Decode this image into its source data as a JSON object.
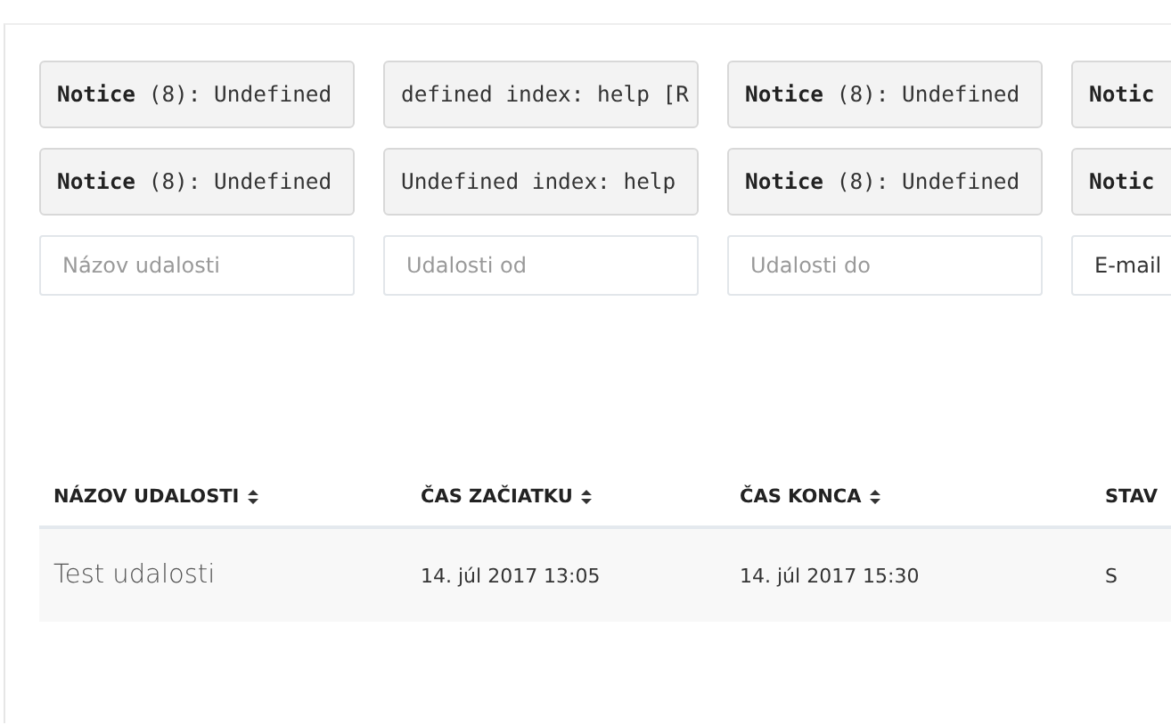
{
  "filter_columns": [
    {
      "notices": [
        "**Notice** (8): Undefined",
        "**Notice** (8): Undefined"
      ],
      "field": {
        "placeholder": "Názov udalosti"
      }
    },
    {
      "notices": [
        "defined index: help [R",
        "Undefined index: help"
      ],
      "field": {
        "placeholder": "Udalosti od"
      }
    },
    {
      "notices": [
        "**Notice** (8): Undefined",
        "**Notice** (8): Undefined"
      ],
      "field": {
        "placeholder": "Udalosti do"
      }
    },
    {
      "notices": [
        "**Notic**",
        "**Notic**"
      ],
      "field": {
        "value": "E-mail"
      }
    }
  ],
  "table": {
    "columns": [
      {
        "label": "NÁZOV UDALOSTI",
        "sortable": true
      },
      {
        "label": "ČAS ZAČIATKU",
        "sortable": true
      },
      {
        "label": "ČAS KONCA",
        "sortable": true
      },
      {
        "label": "STAV",
        "sortable": false
      }
    ],
    "rows": [
      {
        "cells": [
          "Test udalosti",
          "14. júl 2017 13:05",
          "14. júl 2017 15:30",
          "S"
        ]
      }
    ]
  }
}
